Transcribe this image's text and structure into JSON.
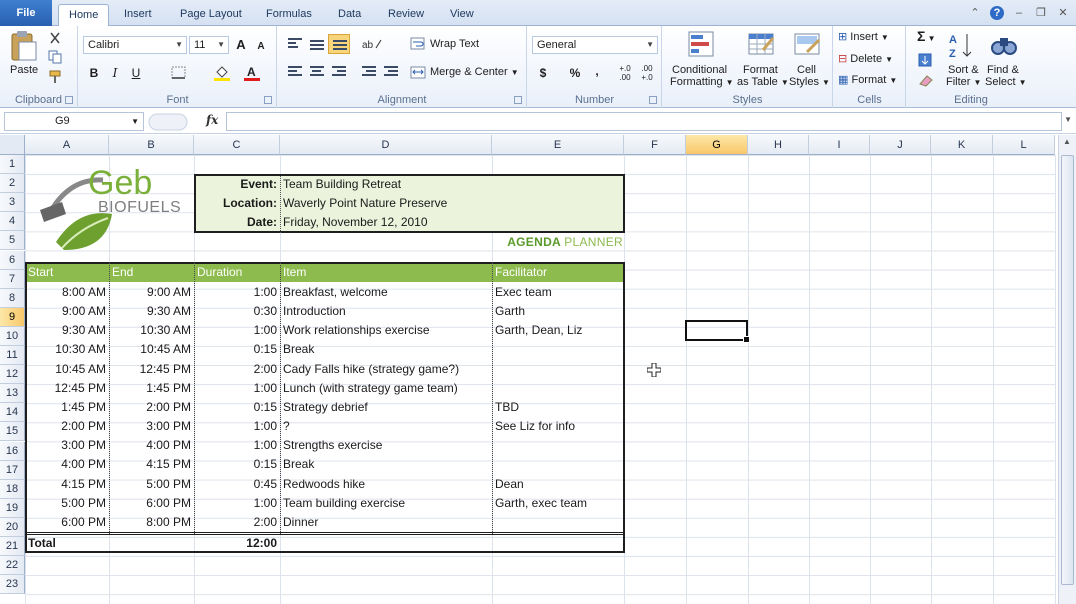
{
  "ribbon": {
    "tabs": [
      "File",
      "Home",
      "Insert",
      "Page Layout",
      "Formulas",
      "Data",
      "Review",
      "View"
    ],
    "active_tab": "Home",
    "clipboard": {
      "paste": "Paste",
      "label": "Clipboard"
    },
    "font": {
      "name": "Calibri",
      "size": "11",
      "label": "Font",
      "bold": "B",
      "italic": "I",
      "underline": "U",
      "grow": "A",
      "shrink": "A"
    },
    "alignment": {
      "wrap_text": "Wrap Text",
      "merge_center": "Merge & Center",
      "label": "Alignment"
    },
    "number": {
      "format": "General",
      "currency": "$",
      "percent": "%",
      "comma": ",",
      "inc_dec": "+.0 .00",
      "dec_dec": ".00 +.0",
      "label": "Number"
    },
    "styles": {
      "conditional_1": "Conditional",
      "conditional_2": "Formatting",
      "format_table_1": "Format",
      "format_table_2": "as Table",
      "cell_styles_1": "Cell",
      "cell_styles_2": "Styles",
      "label": "Styles"
    },
    "cells": {
      "insert": "Insert",
      "delete": "Delete",
      "format": "Format",
      "label": "Cells"
    },
    "editing": {
      "sigma": "Σ",
      "sort_1": "Sort &",
      "sort_2": "Filter",
      "find_1": "Find &",
      "find_2": "Select",
      "label": "Editing"
    }
  },
  "formula_bar": {
    "name_box": "G9",
    "fx": "fx",
    "value": ""
  },
  "columns": [
    "A",
    "B",
    "C",
    "D",
    "E",
    "F",
    "G",
    "H",
    "I",
    "J",
    "K",
    "L"
  ],
  "selected_col": "G",
  "rows": [
    "1",
    "2",
    "3",
    "4",
    "5",
    "6",
    "7",
    "8",
    "9",
    "10",
    "11",
    "12",
    "13",
    "14",
    "15",
    "16",
    "17",
    "18",
    "19",
    "20",
    "21",
    "22",
    "23"
  ],
  "selected_row": "9",
  "logo": {
    "text_1": "Geb",
    "text_2": "BIOFUELS"
  },
  "event": {
    "event_label": "Event:",
    "event_value": "Team Building Retreat",
    "location_label": "Location:",
    "location_value": "Waverly Point Nature Preserve",
    "date_label": "Date:",
    "date_value": "Friday, November 12, 2010"
  },
  "agenda_title": {
    "part1": "AGENDA",
    "part2": "PLANNER"
  },
  "agenda": {
    "headers": [
      "Start",
      "End",
      "Duration",
      "Item",
      "Facilitator"
    ],
    "rows": [
      [
        "8:00 AM",
        "9:00 AM",
        "1:00",
        "Breakfast, welcome",
        "Exec team"
      ],
      [
        "9:00 AM",
        "9:30 AM",
        "0:30",
        "Introduction",
        "Garth"
      ],
      [
        "9:30 AM",
        "10:30 AM",
        "1:00",
        "Work relationships exercise",
        "Garth, Dean, Liz"
      ],
      [
        "10:30 AM",
        "10:45 AM",
        "0:15",
        "Break",
        ""
      ],
      [
        "10:45 AM",
        "12:45 PM",
        "2:00",
        "Cady Falls hike (strategy game?)",
        ""
      ],
      [
        "12:45 PM",
        "1:45 PM",
        "1:00",
        "Lunch (with strategy game team)",
        ""
      ],
      [
        "1:45 PM",
        "2:00 PM",
        "0:15",
        "Strategy debrief",
        "TBD"
      ],
      [
        "2:00 PM",
        "3:00 PM",
        "1:00",
        "?",
        "See Liz for info"
      ],
      [
        "3:00 PM",
        "4:00 PM",
        "1:00",
        "Strengths exercise",
        ""
      ],
      [
        "4:00 PM",
        "4:15 PM",
        "0:15",
        "Break",
        ""
      ],
      [
        "4:15 PM",
        "5:00 PM",
        "0:45",
        "Redwoods hike",
        "Dean"
      ],
      [
        "5:00 PM",
        "6:00 PM",
        "1:00",
        "Team building exercise",
        "Garth, exec team"
      ],
      [
        "6:00 PM",
        "8:00 PM",
        "2:00",
        "Dinner",
        ""
      ]
    ],
    "total_label": "Total",
    "total_value": "12:00"
  },
  "colors": {
    "accent_green": "#8dbb4e",
    "dark_green": "#5a9a2a",
    "event_fill": "#ebf3dc",
    "selection_header": "#f8c86a"
  }
}
